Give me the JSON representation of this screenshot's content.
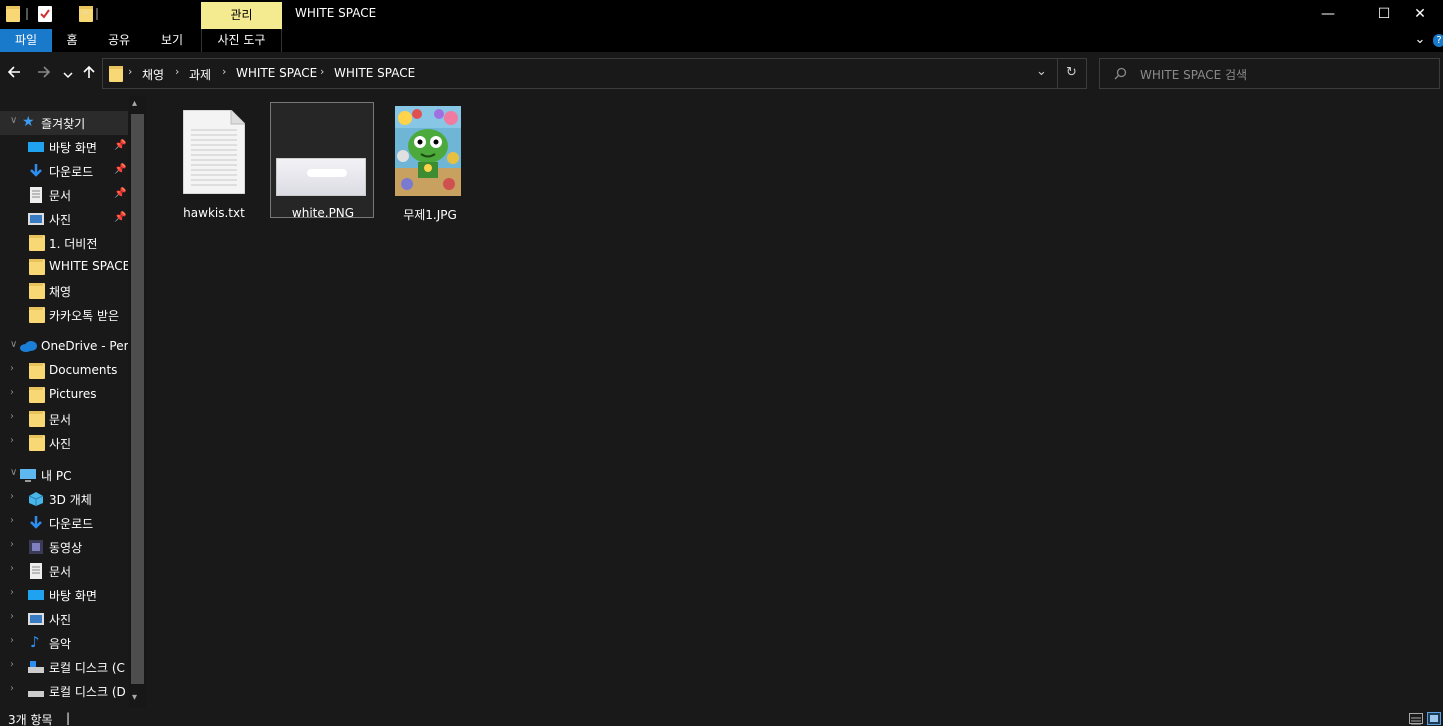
{
  "window": {
    "title": "WHITE SPACE",
    "context_tab_group": "관리",
    "minimize_glyph": "—",
    "maximize_glyph": "☐",
    "close_glyph": "✕"
  },
  "ribbon": {
    "tabs": [
      {
        "label": "파일",
        "active": true
      },
      {
        "label": "홈"
      },
      {
        "label": "공유"
      },
      {
        "label": "보기"
      },
      {
        "label": "사진 도구"
      }
    ],
    "expand_glyph": "⌄",
    "help_glyph": "?"
  },
  "address": {
    "breadcrumbs": [
      "채영",
      "과제",
      "WHITE SPACE",
      "WHITE SPACE"
    ],
    "dropdown_glyph": "⌄",
    "refresh_glyph": "↻"
  },
  "search": {
    "placeholder": "WHITE SPACE 검색"
  },
  "navpane": {
    "quick_access": {
      "label": "즐겨찾기",
      "items": [
        {
          "label": "바탕 화면",
          "icon": "desktop-icon",
          "pinned": true
        },
        {
          "label": "다운로드",
          "icon": "download-icon",
          "pinned": true
        },
        {
          "label": "문서",
          "icon": "document-icon",
          "pinned": true
        },
        {
          "label": "사진",
          "icon": "picture-icon",
          "pinned": true
        },
        {
          "label": "1. 더비전",
          "icon": "folder-icon",
          "pinned": false
        },
        {
          "label": "WHITE SPACE",
          "icon": "folder-icon",
          "pinned": false
        },
        {
          "label": "채영",
          "icon": "folder-icon",
          "pinned": false
        },
        {
          "label": "카카오톡 받은",
          "icon": "folder-icon",
          "pinned": false
        }
      ]
    },
    "onedrive": {
      "label": "OneDrive - Perso",
      "items": [
        {
          "label": "Documents"
        },
        {
          "label": "Pictures"
        },
        {
          "label": "문서"
        },
        {
          "label": "사진"
        }
      ]
    },
    "this_pc": {
      "label": "내 PC",
      "items": [
        {
          "label": "3D 개체",
          "icon": "3d-objects-icon"
        },
        {
          "label": "다운로드",
          "icon": "download-icon"
        },
        {
          "label": "동영상",
          "icon": "video-icon"
        },
        {
          "label": "문서",
          "icon": "document-icon"
        },
        {
          "label": "바탕 화면",
          "icon": "desktop-icon"
        },
        {
          "label": "사진",
          "icon": "picture-icon"
        },
        {
          "label": "음악",
          "icon": "music-icon"
        },
        {
          "label": "로컬 디스크 (C",
          "icon": "drive-c-icon"
        },
        {
          "label": "로컬 디스크 (D",
          "icon": "drive-d-icon"
        }
      ]
    }
  },
  "files": [
    {
      "name": "hawkis.txt",
      "type": "text-file-icon"
    },
    {
      "name": "white.PNG",
      "type": "image-thumbnail",
      "selected": true
    },
    {
      "name": "무제1.JPG",
      "type": "image-thumbnail"
    }
  ],
  "status": {
    "count": "3개 항목",
    "separator": "|"
  },
  "colors": {
    "background": "#191919",
    "titlebar": "#000000",
    "accent": "#1979ca",
    "context_tab": "#f4ea8f",
    "folder": "#f8d775"
  }
}
